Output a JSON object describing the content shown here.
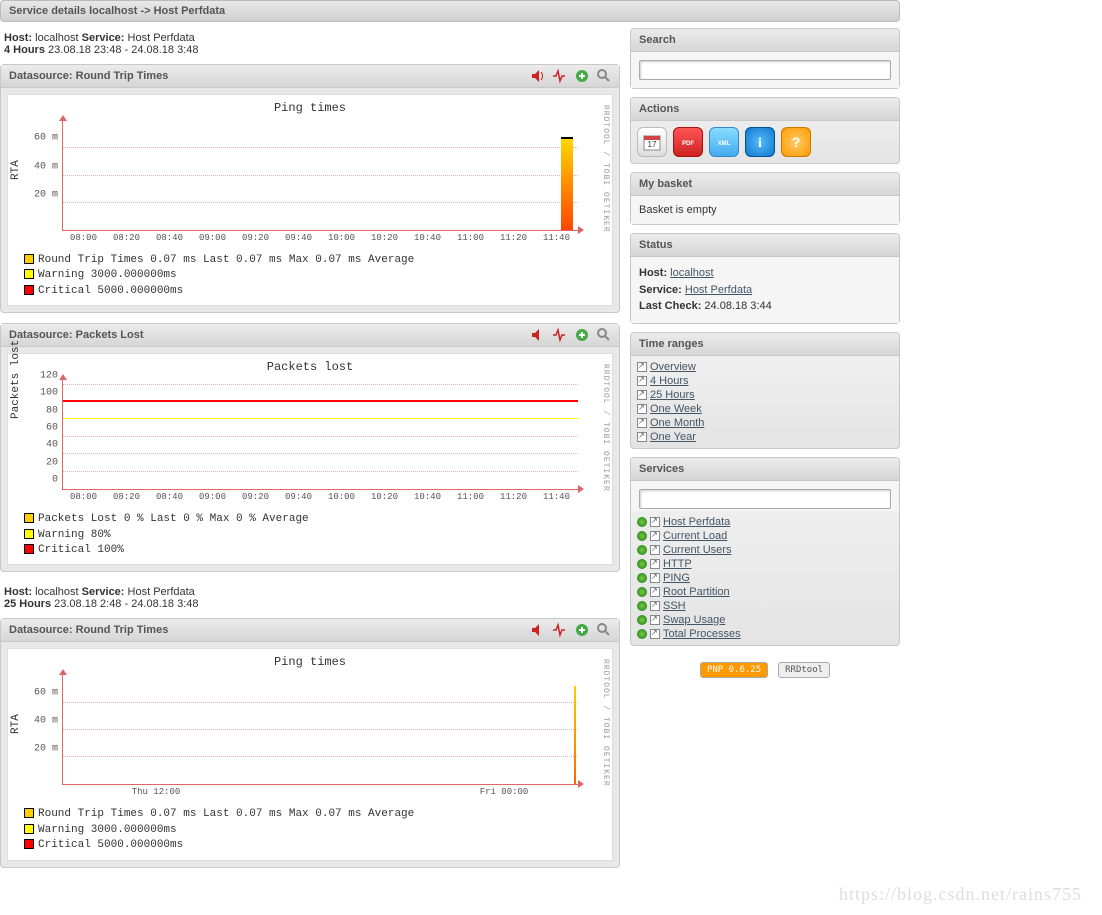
{
  "page_title": "Service details localhost -> Host Perfdata",
  "host_label": "Host:",
  "service_label": "Service:",
  "host_value": "localhost",
  "service_value": "Host Perfdata",
  "sections": [
    {
      "range_label": "4 Hours",
      "range_span": "23.08.18 23:48 - 24.08.18 3:48"
    },
    {
      "range_label": "25 Hours",
      "range_span": "23.08.18 2:48 - 24.08.18 3:48"
    }
  ],
  "ds_rtt": {
    "header": "Datasource: Round Trip Times",
    "title": "Ping times",
    "ylabel": "RTA",
    "yticks": [
      "20 m",
      "40 m",
      "60 m"
    ],
    "xticks_4h": [
      "08:00",
      "08:20",
      "08:40",
      "09:00",
      "09:20",
      "09:40",
      "10:00",
      "10:20",
      "10:40",
      "11:00",
      "11:20",
      "11:40"
    ],
    "xticks_25h": [
      "Thu 12:00",
      "Fri 00:00"
    ],
    "legend1": "Round Trip Times    0.07 ms Last    0.07 ms Max    0.07 ms Average",
    "legend2": "Warning  3000.000000ms",
    "legend3": "Critical 5000.000000ms",
    "colors": {
      "rtt": "#ffcc00",
      "warn": "#ffff00",
      "crit": "#ff0000"
    }
  },
  "ds_pkt": {
    "header": "Datasource: Packets Lost",
    "title": "Packets lost",
    "ylabel": "Packets lost",
    "yticks": [
      "0",
      "20",
      "40",
      "60",
      "80",
      "100",
      "120"
    ],
    "xticks": [
      "08:00",
      "08:20",
      "08:40",
      "09:00",
      "09:20",
      "09:40",
      "10:00",
      "10:20",
      "10:40",
      "11:00",
      "11:20",
      "11:40"
    ],
    "legend1": "Packets Lost     0 % Last     0 % Max     0 % Average",
    "legend2": "Warning  80%",
    "legend3": "Critical 100%",
    "colors": {
      "warn": "#ffff00",
      "crit": "#ff0000"
    }
  },
  "chart_data": [
    {
      "type": "line",
      "title": "Ping times",
      "range": "4 Hours",
      "xlabel": "",
      "ylabel": "RTA",
      "series": [
        {
          "name": "Round Trip Times",
          "unit": "ms",
          "last": 0.07,
          "max": 0.07,
          "avg": 0.07,
          "spike_near": "11:40",
          "spike_value_approx": 70
        }
      ],
      "thresholds": {
        "warning": 3000.0,
        "critical": 5000.0,
        "unit": "ms"
      },
      "xticks": [
        "08:00",
        "08:20",
        "08:40",
        "09:00",
        "09:20",
        "09:40",
        "10:00",
        "10:20",
        "10:40",
        "11:00",
        "11:20",
        "11:40"
      ],
      "yticks_label": [
        "20 m",
        "40 m",
        "60 m"
      ]
    },
    {
      "type": "line",
      "title": "Packets lost",
      "range": "4 Hours",
      "xlabel": "",
      "ylabel": "Packets lost",
      "series": [
        {
          "name": "Packets Lost",
          "unit": "%",
          "last": 0,
          "max": 0,
          "avg": 0
        }
      ],
      "thresholds": {
        "warning": 80,
        "critical": 100,
        "unit": "%"
      },
      "xticks": [
        "08:00",
        "08:20",
        "08:40",
        "09:00",
        "09:20",
        "09:40",
        "10:00",
        "10:20",
        "10:40",
        "11:00",
        "11:20",
        "11:40"
      ],
      "ylim": [
        0,
        120
      ]
    },
    {
      "type": "line",
      "title": "Ping times",
      "range": "25 Hours",
      "xlabel": "",
      "ylabel": "RTA",
      "series": [
        {
          "name": "Round Trip Times",
          "unit": "ms",
          "last": 0.07,
          "max": 0.07,
          "avg": 0.07,
          "spike_near": "Fri 03:00",
          "spike_value_approx": 70
        }
      ],
      "thresholds": {
        "warning": 3000.0,
        "critical": 5000.0,
        "unit": "ms"
      },
      "xticks": [
        "Thu 12:00",
        "Fri 00:00"
      ],
      "yticks_label": [
        "20 m",
        "40 m",
        "60 m"
      ]
    }
  ],
  "rrd_tag": "RRDTOOL / TOBI OETIKER",
  "sidebar": {
    "search": {
      "title": "Search",
      "placeholder": ""
    },
    "actions": {
      "title": "Actions"
    },
    "basket": {
      "title": "My basket",
      "empty": "Basket is empty"
    },
    "status": {
      "title": "Status",
      "host_label": "Host:",
      "host_value": "localhost",
      "service_label": "Service:",
      "service_value": "Host Perfdata",
      "lastcheck_label": "Last Check:",
      "lastcheck_value": "24.08.18 3:44"
    },
    "timeranges": {
      "title": "Time ranges",
      "items": [
        "Overview",
        "4 Hours",
        "25 Hours",
        "One Week",
        "One Month",
        "One Year"
      ]
    },
    "services": {
      "title": "Services",
      "items": [
        "Host Perfdata",
        "Current Load",
        "Current Users",
        "HTTP",
        "PING",
        "Root Partition",
        "SSH",
        "Swap Usage",
        "Total Processes"
      ]
    },
    "badges": {
      "pnp": "PNP 0.6.25",
      "rrd": "RRDtool"
    }
  },
  "watermark": "https://blog.csdn.net/rains755"
}
